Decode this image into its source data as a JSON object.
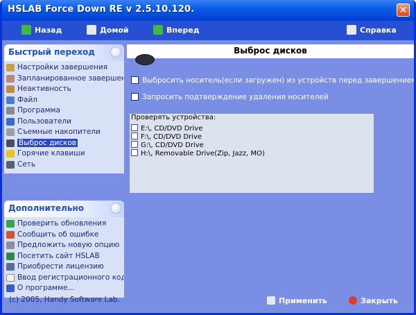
{
  "window": {
    "title": "HSLAB Force Down RE v 2.5.10.120."
  },
  "toolbar": {
    "back_label": "Назад",
    "home_label": "Домой",
    "forward_label": "Вперед",
    "help_label": "Справка"
  },
  "quick_panel": {
    "title": "Быстрый переход",
    "items": [
      {
        "label": "Настройки завершения",
        "icon": "hourglass-icon"
      },
      {
        "label": "Запланированное завершение",
        "icon": "clock-icon"
      },
      {
        "label": "Неактивность",
        "icon": "timer-icon"
      },
      {
        "label": "Файл",
        "icon": "file-search-icon"
      },
      {
        "label": "Программа",
        "icon": "program-icon"
      },
      {
        "label": "Пользователи",
        "icon": "users-icon"
      },
      {
        "label": "Съемные накопители",
        "icon": "drive-icon"
      },
      {
        "label": "Выброс дисков",
        "icon": "eject-icon"
      },
      {
        "label": "Горячие клавиши",
        "icon": "lightning-icon"
      },
      {
        "label": "Сеть",
        "icon": "network-icon"
      }
    ]
  },
  "extra_panel": {
    "title": "Дополнительно",
    "items": [
      {
        "label": "Проверить обновления",
        "icon": "globe-icon"
      },
      {
        "label": "Сообщить об ошибке",
        "icon": "bug-icon"
      },
      {
        "label": "Предложить новую опцию",
        "icon": "suggest-icon"
      },
      {
        "label": "Посетить сайт HSLAB",
        "icon": "web-icon"
      },
      {
        "label": "Приобрести лицензию",
        "icon": "license-icon"
      },
      {
        "label": "Ввод регистрационного кода",
        "icon": "document-icon"
      },
      {
        "label": "О программе...",
        "icon": "info-icon"
      }
    ]
  },
  "content": {
    "title": "Выброс дисков",
    "option_eject": "Выбросить носитель(если загружен) из устройств перед завершением",
    "option_confirm": "Запросить подтверждение удаления носителей",
    "devices_label": "Проверять устройства:",
    "devices": [
      "E:\\, CD/DVD Drive",
      "F:\\, CD/DVD Drive",
      "G:\\, CD/DVD Drive",
      "H:\\, Removable Drive(Zip, Jazz, MO)"
    ]
  },
  "footer": {
    "copyright": "(c) 2005, Handy Software Lab.",
    "apply_label": "Применить",
    "close_label": "Закрыть"
  },
  "colors": {
    "titlebar": "#0a5de8",
    "background": "#7b8ee6",
    "panel_body": "#d9e1f7",
    "selected": "#2a49c9"
  }
}
